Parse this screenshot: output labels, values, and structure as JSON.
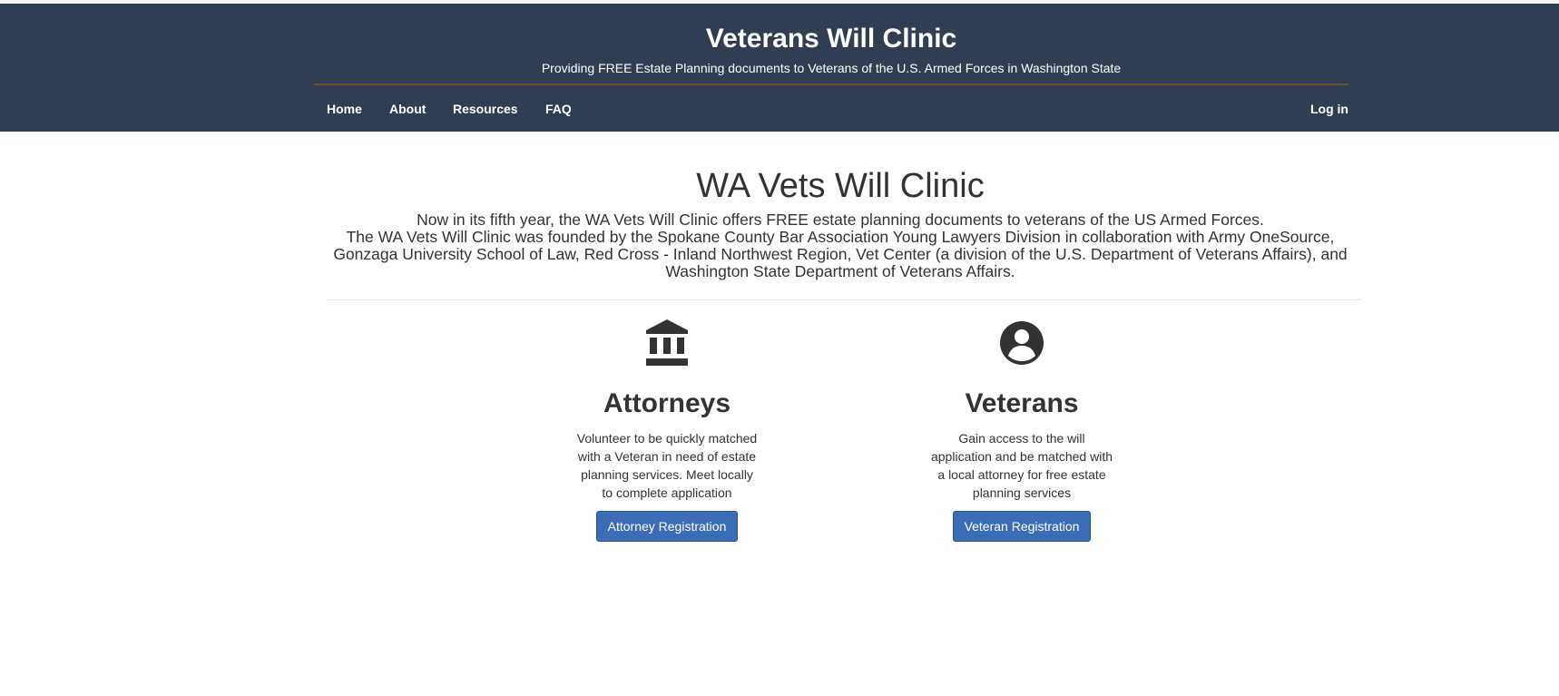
{
  "header": {
    "title": "Veterans Will Clinic",
    "subtitle": "Providing FREE Estate Planning documents to Veterans of the U.S. Armed Forces in Washington State",
    "background_color": "#2f3e51",
    "rule_color": "#6b4e2a"
  },
  "nav": {
    "home": "Home",
    "about": "About",
    "resources": "Resources",
    "faq": "FAQ",
    "login": "Log in"
  },
  "main": {
    "title": "WA Vets Will Clinic",
    "intro_line1": "Now in its fifth year, the WA Vets Will Clinic offers FREE estate planning documents to veterans of the US Armed Forces.",
    "intro_line2": "The WA Vets Will Clinic was founded by the Spokane County Bar Association Young Lawyers Division in collaboration with Army OneSource, Gonzaga University School of Law, Red Cross - Inland Northwest Region, Vet Center (a division of the U.S. Department of Veterans Affairs), and Washington State Department of Veterans Affairs."
  },
  "cards": {
    "attorneys": {
      "icon": "bank-icon",
      "heading": "Attorneys",
      "text": "Volunteer to be quickly matched with a Veteran in need of estate planning services. Meet locally to complete application",
      "button": "Attorney Registration"
    },
    "veterans": {
      "icon": "account-circle-icon",
      "heading": "Veterans",
      "text": "Gain access to the will application and be matched with a local attorney for free estate planning services",
      "button": "Veteran Registration"
    }
  },
  "colors": {
    "button_primary": "#3a6db5",
    "text": "#333333"
  }
}
